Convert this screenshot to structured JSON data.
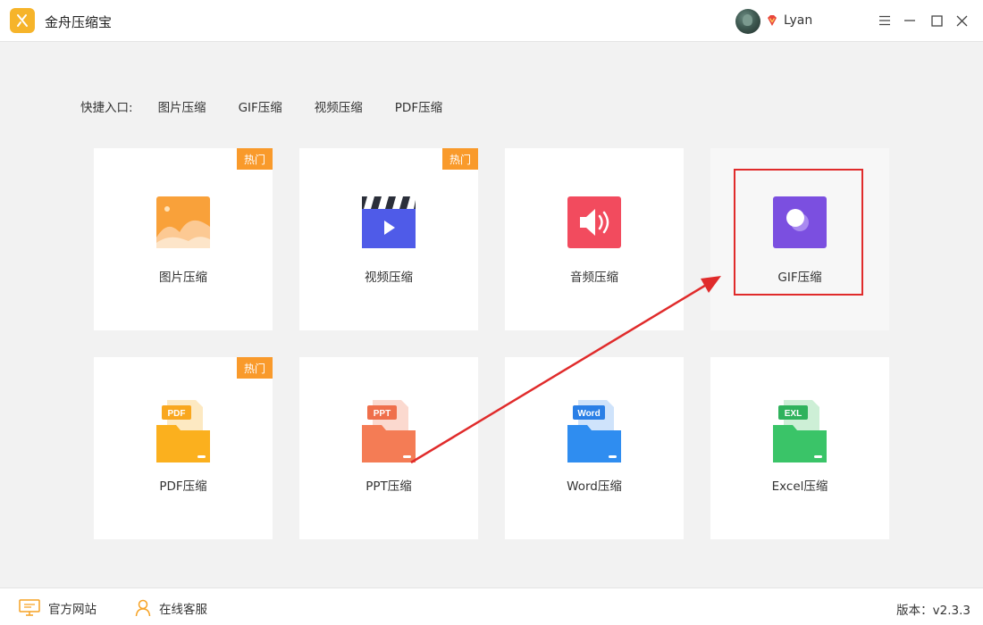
{
  "app": {
    "title": "金舟压缩宝"
  },
  "user": {
    "name": "Lyan"
  },
  "quick_access": {
    "label": "快捷入口:",
    "links": [
      "图片压缩",
      "GIF压缩",
      "视频压缩",
      "PDF压缩"
    ]
  },
  "cards": [
    {
      "label": "图片压缩",
      "badge": "热门"
    },
    {
      "label": "视频压缩",
      "badge": "热门"
    },
    {
      "label": "音频压缩"
    },
    {
      "label": "GIF压缩"
    },
    {
      "label": "PDF压缩",
      "badge": "热门"
    },
    {
      "label": "PPT压缩"
    },
    {
      "label": "Word压缩"
    },
    {
      "label": "Excel压缩"
    }
  ],
  "file_tags": {
    "pdf": "PDF",
    "ppt": "PPT",
    "word": "Word",
    "excel": "EXL"
  },
  "footer": {
    "site": "官方网站",
    "support": "在线客服",
    "version": "版本：v2.3.3"
  },
  "colors": {
    "accent_orange": "#f99a2b",
    "video_blue": "#4f5be8",
    "audio_red": "#f24b5e",
    "gif_purple": "#7b4fe0",
    "annotation_red": "#e02b2b"
  }
}
